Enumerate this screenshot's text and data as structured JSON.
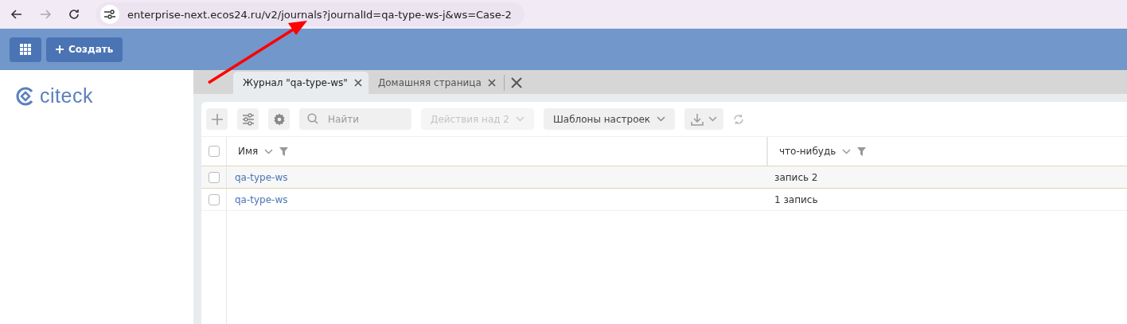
{
  "browser": {
    "url": "enterprise-next.ecos24.ru/v2/journals?journalId=qa-type-ws-j&ws=Case-2"
  },
  "header": {
    "create_button": "Создать"
  },
  "sidebar": {
    "logo": "citeck"
  },
  "tabs": [
    {
      "label": "Журнал \"qa-type-ws\"",
      "selected": true
    },
    {
      "label": "Домашняя страница",
      "selected": false
    }
  ],
  "toolbar": {
    "search": {
      "placeholder": "Найти"
    },
    "actions_button": {
      "label": "Действия над 2",
      "disabled": true
    },
    "templates_button": {
      "label": "Шаблоны настроек",
      "disabled": false
    }
  },
  "table": {
    "select_all": {
      "checked": false
    },
    "columns": [
      "Имя",
      "что-нибудь"
    ],
    "rows": [
      {
        "checked": false,
        "highlighted": true,
        "cells": [
          "qa-type-ws",
          "запись 2"
        ]
      },
      {
        "checked": false,
        "highlighted": false,
        "cells": [
          "qa-type-ws",
          "1 запись"
        ]
      }
    ]
  }
}
